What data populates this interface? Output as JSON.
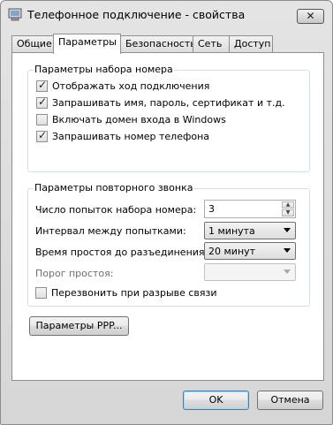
{
  "window": {
    "title": "Телефонное подключение - свойства",
    "close_glyph": "✕"
  },
  "tabs": [
    {
      "label": "Общие"
    },
    {
      "label": "Параметры"
    },
    {
      "label": "Безопасность"
    },
    {
      "label": "Сеть"
    },
    {
      "label": "Доступ"
    }
  ],
  "dial_group": {
    "title": "Параметры набора номера",
    "options": [
      {
        "label": "Отображать ход подключения",
        "checked": true
      },
      {
        "label": "Запрашивать имя, пароль, сертификат и т.д.",
        "checked": true
      },
      {
        "label": "Включать домен входа в Windows",
        "checked": false
      },
      {
        "label": "Запрашивать номер телефона",
        "checked": true
      }
    ]
  },
  "redial_group": {
    "title": "Параметры повторного звонка",
    "attempts_label": "Число попыток набора номера:",
    "attempts_value": "3",
    "interval_label": "Интервал между попытками:",
    "interval_value": "1 минута",
    "idle_label": "Время простоя до разъединения:",
    "idle_value": "20 минут",
    "threshold_label": "Порог простоя:",
    "threshold_value": "",
    "redial_label": "Перезвонить при разрыве связи",
    "redial_checked": false
  },
  "ppp_button": "Параметры PPP...",
  "ok_button": "OK",
  "cancel_button": "Отмена",
  "check_glyph": "✓"
}
